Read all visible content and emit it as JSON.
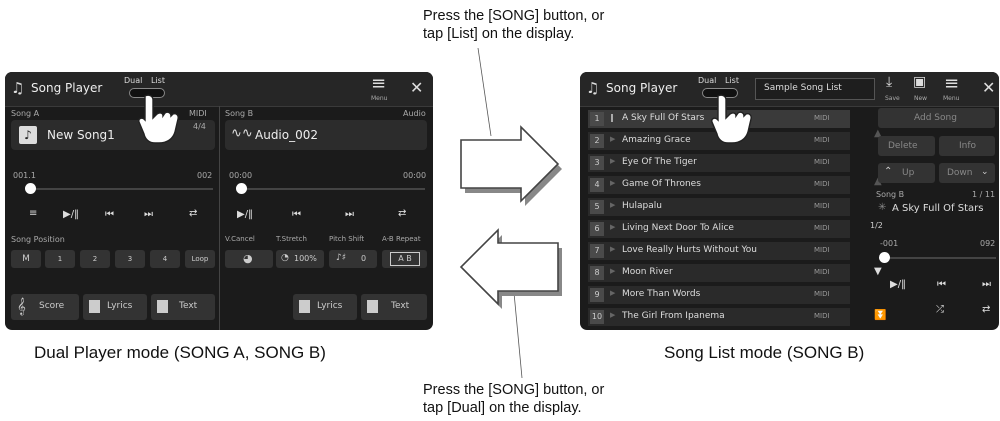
{
  "annotations": {
    "top_line1": "Press the [SONG] button, or",
    "top_line2": "tap [List] on the display.",
    "bottom_line1": "Press the [SONG] button, or",
    "bottom_line2": "tap [Dual] on the display."
  },
  "captions": {
    "left": "Dual Player mode (SONG A, SONG B)",
    "right": "Song List mode (SONG B)"
  },
  "dual": {
    "title": "Song Player",
    "dual_label": "Dual",
    "list_label": "List",
    "menu_label": "Menu",
    "song_a": {
      "label": "Song A",
      "type": "MIDI",
      "measure": "4/4",
      "name": "New Song1",
      "position": "001.1",
      "end": "002"
    },
    "song_b": {
      "label": "Song B",
      "type": "Audio",
      "name": "Audio_002",
      "time": "00:00",
      "end": "00:00"
    },
    "song_position_label": "Song Position",
    "positions": [
      "M",
      "1",
      "2",
      "3",
      "4",
      "Loop"
    ],
    "controls_b_labels": [
      "V.Cancel",
      "T.Stretch",
      "Pitch Shift",
      "A-B Repeat"
    ],
    "tstretch_value": "100%",
    "pitch_value": "0",
    "ab_label": "A B",
    "score_label": "Score",
    "lyrics_label": "Lyrics",
    "text_label": "Text"
  },
  "list": {
    "title": "Song Player",
    "dual_label": "Dual",
    "list_label": "List",
    "list_name": "Sample Song List",
    "save_label": "Save",
    "new_label": "New",
    "menu_label": "Menu",
    "songs": [
      {
        "num": "1",
        "name": "A Sky Full Of Stars",
        "tag": "MIDI"
      },
      {
        "num": "2",
        "name": "Amazing Grace",
        "tag": "MIDI"
      },
      {
        "num": "3",
        "name": "Eye Of The Tiger",
        "tag": "MIDI"
      },
      {
        "num": "4",
        "name": "Game Of Thrones",
        "tag": "MIDI"
      },
      {
        "num": "5",
        "name": "Hulapalu",
        "tag": "MIDI"
      },
      {
        "num": "6",
        "name": "Living Next Door To Alice",
        "tag": "MIDI"
      },
      {
        "num": "7",
        "name": "Love Really Hurts Without You",
        "tag": "MIDI"
      },
      {
        "num": "8",
        "name": "Moon River",
        "tag": "MIDI"
      },
      {
        "num": "9",
        "name": "More Than Words",
        "tag": "MIDI"
      },
      {
        "num": "10",
        "name": "The Girl From Ipanema",
        "tag": "MIDI"
      }
    ],
    "page": "1/2",
    "add_song": "Add Song",
    "delete": "Delete",
    "info": "Info",
    "up": "Up",
    "down": "Down",
    "song_b_label": "Song B",
    "song_b_index": "1 / 11",
    "current_song": "A Sky Full Of Stars",
    "start": "-001",
    "end": "092"
  }
}
